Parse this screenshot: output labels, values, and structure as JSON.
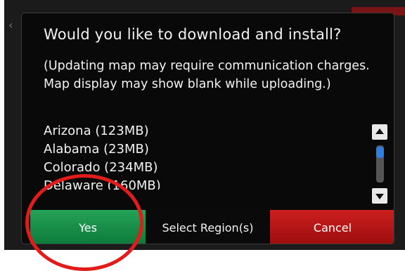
{
  "dialog": {
    "question": "Would you like to download and install?",
    "note": "(Updating map may require communication charges. Map display may show blank while uploading.)",
    "regions": [
      "Arizona (123MB)",
      "Alabama (23MB)",
      "Colorado (234MB)",
      "Delaware (160MB)"
    ],
    "buttons": {
      "yes": "Yes",
      "select_regions": "Select Region(s)",
      "cancel": "Cancel"
    }
  },
  "scrollbar": {
    "up_icon": "triangle-up-icon",
    "down_icon": "triangle-down-icon",
    "position": 0.0
  },
  "colors": {
    "yes_button": "#1a8f47",
    "cancel_button": "#c01717",
    "highlight_circle": "#e21b1b",
    "scroll_thumb": "#2f7fe0"
  }
}
